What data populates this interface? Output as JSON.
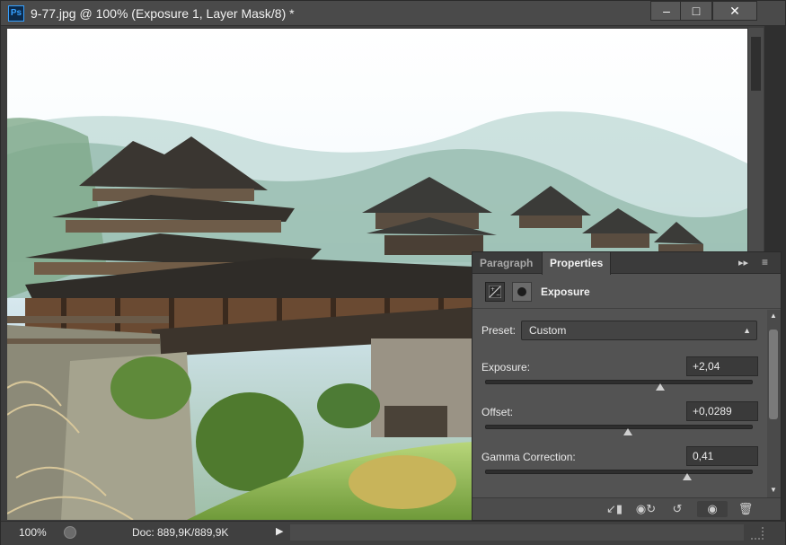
{
  "window": {
    "app_badge": "Ps",
    "title": "9-77.jpg @ 100% (Exposure 1, Layer Mask/8) *",
    "min_glyph": "–",
    "max_glyph": "□",
    "close_glyph": "✕"
  },
  "statusbar": {
    "zoom": "100%",
    "doc_info": "Doc: 889,9K/889,9K",
    "arrow": "▶"
  },
  "panel": {
    "tabs": [
      "Paragraph",
      "Properties"
    ],
    "active_tab": "Properties",
    "collapse_glyph": "▸▸",
    "menu_glyph": "≡",
    "header_title": "Exposure",
    "preset": {
      "label": "Preset:",
      "value": "Custom"
    },
    "sliders": [
      {
        "label": "Exposure:",
        "value": "+2,04",
        "position": 0.65
      },
      {
        "label": "Offset:",
        "value": "+0,0289",
        "position": 0.53
      },
      {
        "label": "Gamma Correction:",
        "value": "0,41",
        "position": 0.75
      }
    ],
    "footer_icons": [
      "clip-to-layer-icon",
      "view-previous-state-icon",
      "reset-icon",
      "visibility-eye-icon",
      "trash-icon"
    ]
  }
}
